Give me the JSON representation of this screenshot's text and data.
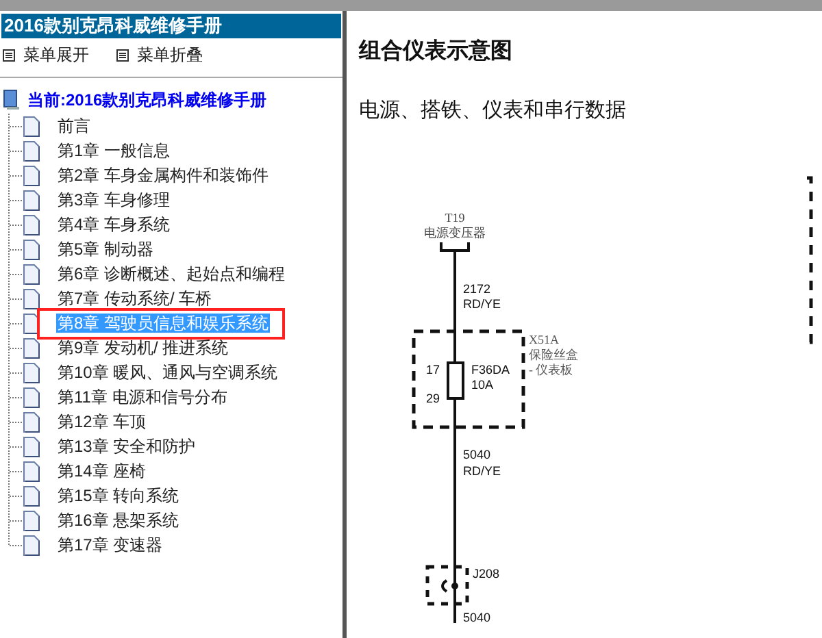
{
  "sidebar": {
    "title": "2016款别克昂科威维修手册",
    "menu_buttons": [
      {
        "label": "菜单展开"
      },
      {
        "label": "菜单折叠"
      }
    ],
    "tree": {
      "label": "当前:2016款别克昂科威维修手册",
      "children": [
        {
          "label": "前言",
          "selected": false
        },
        {
          "label": "第1章 一般信息",
          "selected": false
        },
        {
          "label": "第2章 车身金属构件和装饰件",
          "selected": false
        },
        {
          "label": "第3章 车身修理",
          "selected": false
        },
        {
          "label": "第4章 车身系统",
          "selected": false
        },
        {
          "label": "第5章 制动器",
          "selected": false
        },
        {
          "label": "第6章 诊断概述、起始点和编程",
          "selected": false
        },
        {
          "label": "第7章 传动系统/ 车桥",
          "selected": false
        },
        {
          "label": "第8章 驾驶员信息和娱乐系统",
          "selected": true
        },
        {
          "label": "第9章 发动机/ 推进系统",
          "selected": false
        },
        {
          "label": "第10章 暖风、通风与空调系统",
          "selected": false
        },
        {
          "label": "第11章 电源和信号分布",
          "selected": false
        },
        {
          "label": "第12章 车顶",
          "selected": false
        },
        {
          "label": "第13章 安全和防护",
          "selected": false
        },
        {
          "label": "第14章 座椅",
          "selected": false
        },
        {
          "label": "第15章 转向系统",
          "selected": false
        },
        {
          "label": "第16章 悬架系统",
          "selected": false
        },
        {
          "label": "第17章 变速器",
          "selected": false
        }
      ]
    }
  },
  "content": {
    "title": "组合仪表示意图",
    "subtitle": "电源、搭铁、仪表和串行数据",
    "diagram": {
      "source_id": "T19",
      "source_name": "电源变压器",
      "wire_1": [
        "2172",
        "RD/YE"
      ],
      "fuse_box_id": "X51A",
      "fuse_box_name": [
        "保险丝盒",
        "- 仪表板"
      ],
      "pin_in": "17",
      "pin_out": "29",
      "fuse": [
        "F36DA",
        "10A"
      ],
      "wire_2": [
        "5040",
        "RD/YE"
      ],
      "splice": "J208",
      "wire_3": "5040"
    }
  }
}
